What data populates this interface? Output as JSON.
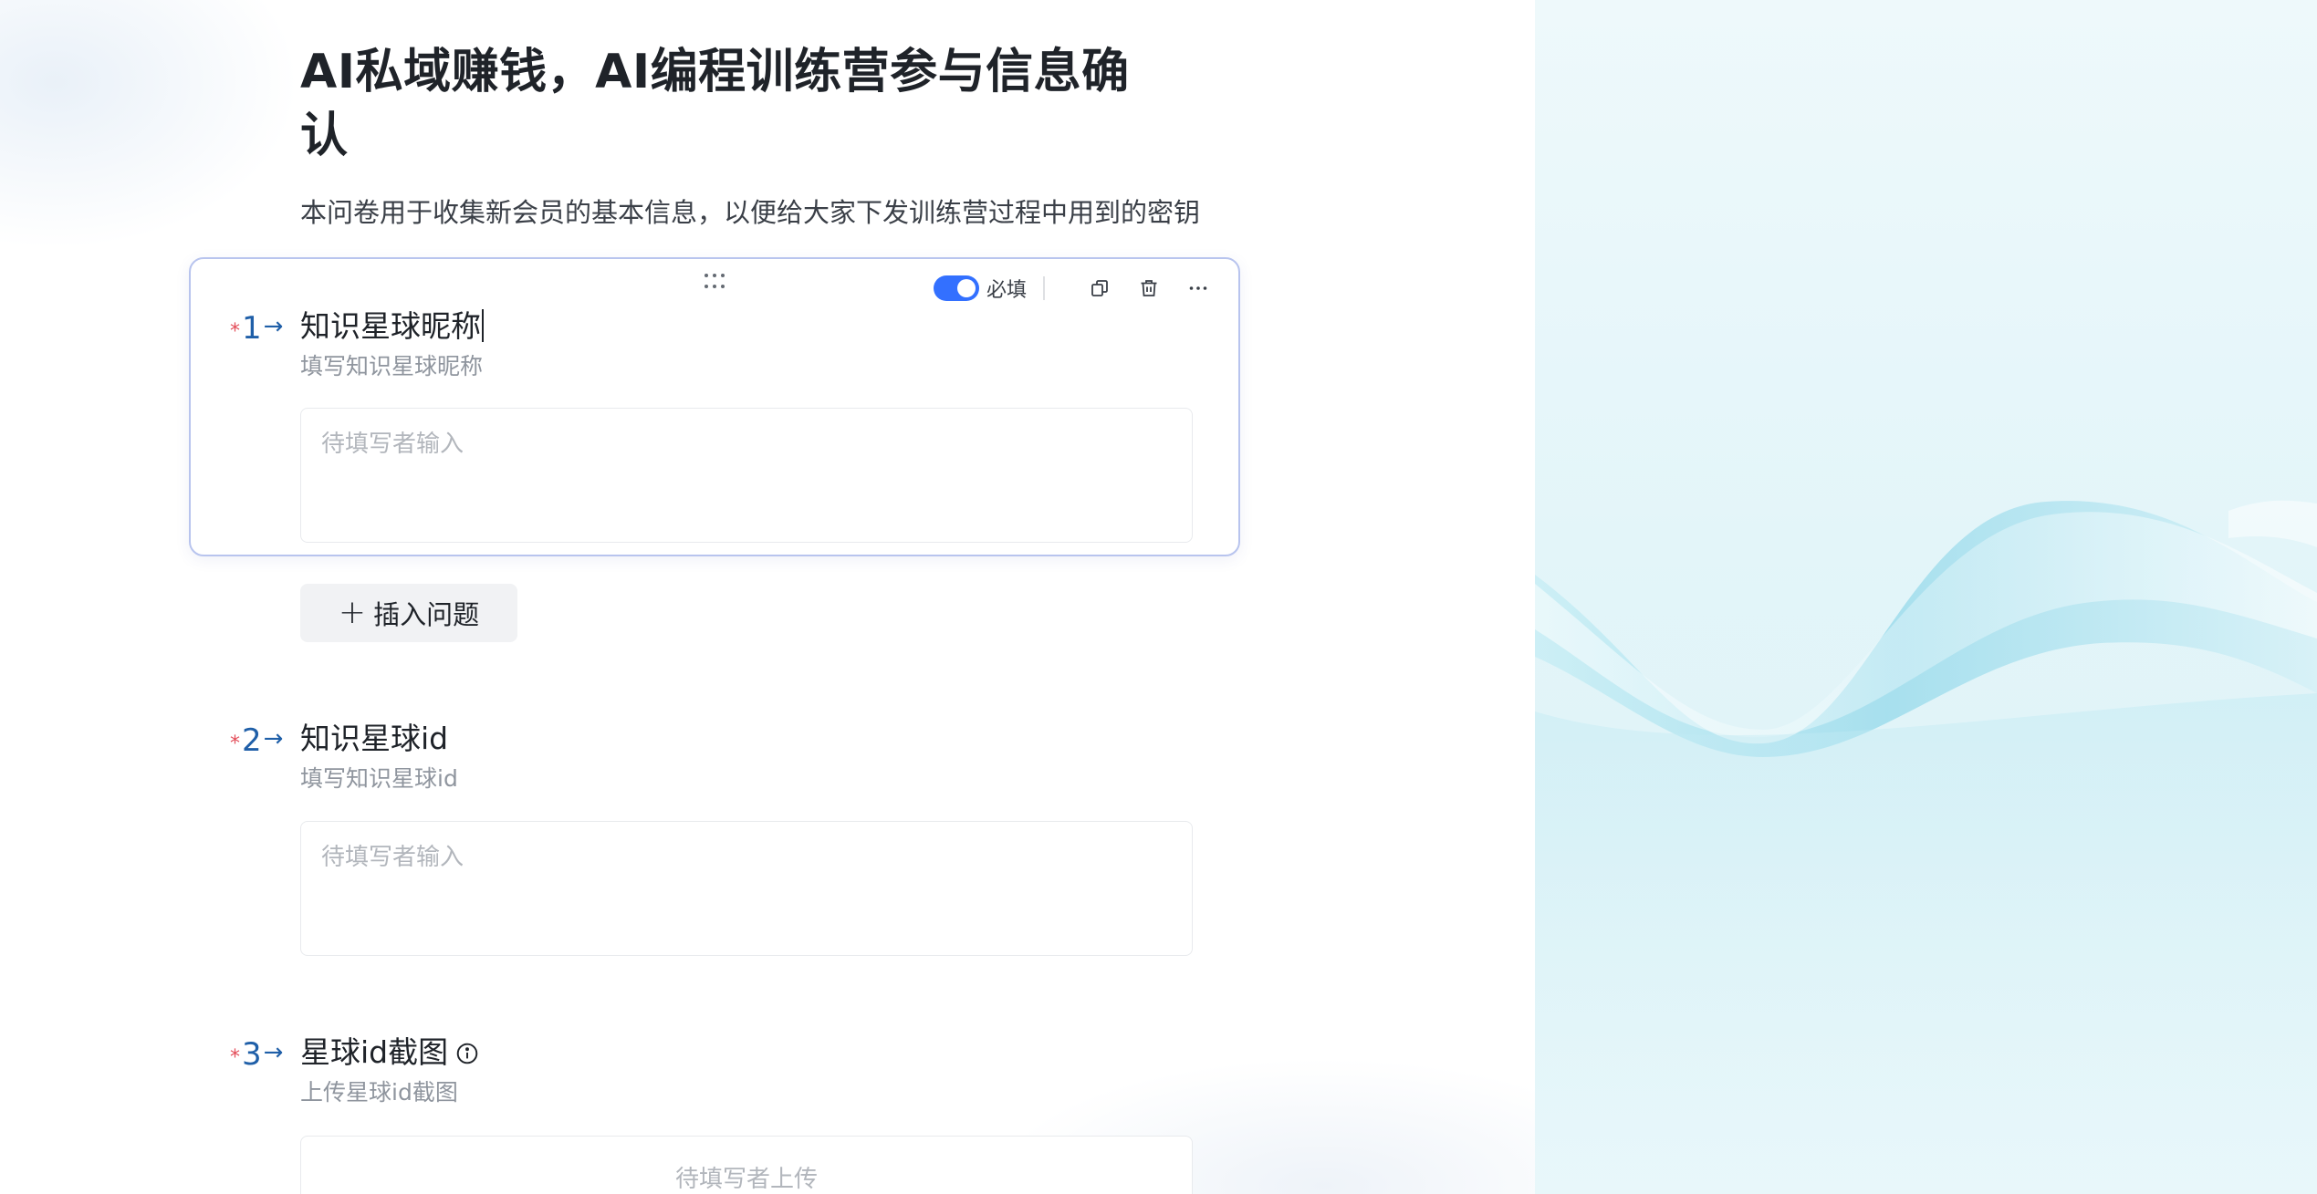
{
  "form": {
    "title": "AI私域赚钱，AI编程训练营参与信息确认",
    "description": "本问卷用于收集新会员的基本信息，以便给大家下发训练营过程中用到的密钥"
  },
  "toolbar": {
    "required_label": "必填",
    "required_on": true,
    "icons": [
      "drag-handle-icon",
      "toggle-switch",
      "copy-icon",
      "trash-icon",
      "more-icon"
    ]
  },
  "questions": [
    {
      "star": "*",
      "number": "1",
      "arrow": "→",
      "title": "知识星球昵称",
      "subtitle": "填写知识星球昵称",
      "placeholder": "待填写者输入"
    },
    {
      "star": "*",
      "number": "2",
      "arrow": "→",
      "title": "知识星球id",
      "subtitle": "填写知识星球id",
      "placeholder": "待填写者输入"
    },
    {
      "star": "*",
      "number": "3",
      "arrow": "→",
      "title": "星球id截图",
      "subtitle": "上传星球id截图",
      "placeholder": "待填写者上传"
    }
  ],
  "insert_button": {
    "plus": "+",
    "label": "插入问题"
  },
  "colors": {
    "accent": "#3370ff",
    "required_star": "#e34d59",
    "card_border": "#b8c4ee"
  }
}
